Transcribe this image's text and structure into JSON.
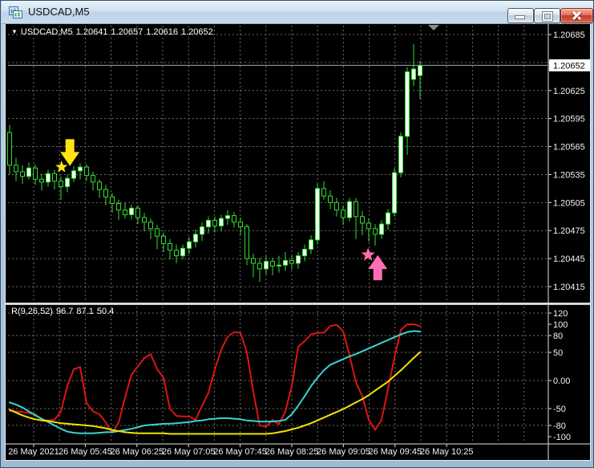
{
  "window": {
    "title": "USDCAD,M5",
    "controls": {
      "minimize": "minimize",
      "maximize": "maximize",
      "close": "close"
    }
  },
  "chart_header": {
    "dropdown": "▼",
    "symbol": "USDCAD,M5",
    "open": "1.20641",
    "high": "1.20657",
    "low": "1.20616",
    "close": "1.20652"
  },
  "indicator_header": {
    "label": "R(9,26,52)",
    "value1": "96.7",
    "value2": "87.1",
    "value3": "50.4"
  },
  "price_tag": "1.20652",
  "colors": {
    "background": "#000000",
    "grid": "#6F6F6F",
    "frame": "#E2E2E2",
    "candle": "#33DD33",
    "bull_fill": "#F2FFF2",
    "bear_fill": "#000000",
    "red_line": "#DE1414",
    "cyan_line": "#3BD2D2",
    "yellow_line": "#F2E400",
    "arrow_yellow": "#FFE312",
    "arrow_pink": "#FF6EB4",
    "price_line": "#A6A6A6",
    "axis_text": "#F2F2F2",
    "bar_marker": "#8C8C8C"
  },
  "chart_data": {
    "type": "candlestick",
    "symbol": "USDCAD",
    "timeframe": "M5",
    "title": "USDCAD,M5 1.20641 1.20657 1.20616 1.20652",
    "current_price": 1.20652,
    "price_axis_ticks": [
      "1.20685",
      "1.20655",
      "1.20625",
      "1.20595",
      "1.20565",
      "1.20535",
      "1.20505",
      "1.20475",
      "1.20445",
      "1.20415"
    ],
    "time_axis_labels": [
      "26 May 2021",
      "26 May 05:45",
      "26 May 06:25",
      "26 May 07:05",
      "26 May 07:45",
      "26 May 08:25",
      "26 May 09:05",
      "26 May 09:45",
      "26 May 10:25"
    ],
    "candles": [
      [
        1.2058,
        1.20588,
        1.20535,
        1.20545
      ],
      [
        1.20545,
        1.20553,
        1.20528,
        1.20538
      ],
      [
        1.20538,
        1.20545,
        1.20525,
        1.20533
      ],
      [
        1.20533,
        1.20548,
        1.2053,
        1.20542
      ],
      [
        1.20542,
        1.20546,
        1.20524,
        1.2053
      ],
      [
        1.2053,
        1.20536,
        1.20518,
        1.20527
      ],
      [
        1.20527,
        1.2054,
        1.20522,
        1.20536
      ],
      [
        1.20536,
        1.2054,
        1.20519,
        1.20528
      ],
      [
        1.20528,
        1.20533,
        1.20508,
        1.20522
      ],
      [
        1.20522,
        1.20535,
        1.20516,
        1.20531
      ],
      [
        1.20531,
        1.20544,
        1.20527,
        1.20539
      ],
      [
        1.20539,
        1.20547,
        1.2053,
        1.20543
      ],
      [
        1.20543,
        1.20546,
        1.20528,
        1.20534
      ],
      [
        1.20534,
        1.20538,
        1.20518,
        1.20527
      ],
      [
        1.20527,
        1.2053,
        1.2051,
        1.20519
      ],
      [
        1.20519,
        1.20524,
        1.20502,
        1.20511
      ],
      [
        1.20511,
        1.20515,
        1.20494,
        1.20504
      ],
      [
        1.20504,
        1.20508,
        1.20486,
        1.20497
      ],
      [
        1.20497,
        1.20505,
        1.20488,
        1.20492
      ],
      [
        1.20492,
        1.20503,
        1.20487,
        1.20499
      ],
      [
        1.20499,
        1.20502,
        1.20482,
        1.20489
      ],
      [
        1.20489,
        1.20494,
        1.20474,
        1.20484
      ],
      [
        1.20484,
        1.20488,
        1.20466,
        1.20477
      ],
      [
        1.20477,
        1.20481,
        1.20455,
        1.20469
      ],
      [
        1.20469,
        1.20473,
        1.20452,
        1.20461
      ],
      [
        1.20461,
        1.20466,
        1.20444,
        1.20454
      ],
      [
        1.20454,
        1.2046,
        1.2044,
        1.20448
      ],
      [
        1.20448,
        1.2046,
        1.20444,
        1.20456
      ],
      [
        1.20456,
        1.20468,
        1.2045,
        1.20463
      ],
      [
        1.20463,
        1.20476,
        1.20457,
        1.20471
      ],
      [
        1.20471,
        1.20484,
        1.20464,
        1.20479
      ],
      [
        1.20479,
        1.2049,
        1.20472,
        1.20486
      ],
      [
        1.20486,
        1.2049,
        1.20473,
        1.2048
      ],
      [
        1.2048,
        1.20492,
        1.20474,
        1.20488
      ],
      [
        1.20488,
        1.20497,
        1.20481,
        1.20491
      ],
      [
        1.20491,
        1.20495,
        1.20478,
        1.20484
      ],
      [
        1.20484,
        1.20489,
        1.2047,
        1.20479
      ],
      [
        1.20479,
        1.20482,
        1.20438,
        1.20445
      ],
      [
        1.20445,
        1.2045,
        1.20425,
        1.2044
      ],
      [
        1.2044,
        1.20446,
        1.2042,
        1.20434
      ],
      [
        1.20434,
        1.20448,
        1.20428,
        1.20442
      ],
      [
        1.20442,
        1.20446,
        1.20427,
        1.20437
      ],
      [
        1.20437,
        1.20448,
        1.2043,
        1.20438
      ],
      [
        1.20438,
        1.20452,
        1.20432,
        1.20443
      ],
      [
        1.20443,
        1.20448,
        1.20433,
        1.2044
      ],
      [
        1.2044,
        1.20452,
        1.20434,
        1.20448
      ],
      [
        1.20448,
        1.2046,
        1.20442,
        1.20455
      ],
      [
        1.20455,
        1.2047,
        1.2045,
        1.20465
      ],
      [
        1.20465,
        1.20525,
        1.2046,
        1.2052
      ],
      [
        1.2052,
        1.20528,
        1.20508,
        1.20512
      ],
      [
        1.20512,
        1.20518,
        1.20498,
        1.20505
      ],
      [
        1.20505,
        1.2051,
        1.2049,
        1.20497
      ],
      [
        1.20497,
        1.20502,
        1.20481,
        1.20489
      ],
      [
        1.20489,
        1.2051,
        1.20485,
        1.20506
      ],
      [
        1.20506,
        1.2051,
        1.20466,
        1.2049
      ],
      [
        1.2049,
        1.20496,
        1.2047,
        1.20483
      ],
      [
        1.20483,
        1.20488,
        1.20463,
        1.20477
      ],
      [
        1.20477,
        1.20482,
        1.20459,
        1.20471
      ],
      [
        1.20471,
        1.20486,
        1.20466,
        1.20482
      ],
      [
        1.20482,
        1.20498,
        1.20476,
        1.20494
      ],
      [
        1.20494,
        1.20542,
        1.2049,
        1.20537
      ],
      [
        1.20537,
        1.2058,
        1.20532,
        1.20576
      ],
      [
        1.20576,
        1.2065,
        1.20556,
        1.20645
      ],
      [
        1.20637,
        1.20675,
        1.2063,
        1.20648
      ],
      [
        1.20641,
        1.20657,
        1.20616,
        1.20652
      ]
    ],
    "markers": [
      {
        "shape": "star",
        "color": "#FFE312",
        "bar": 8.1,
        "price": 1.20543,
        "size": 8
      },
      {
        "shape": "arrow-down",
        "color": "#FFE312",
        "bar": 9.4,
        "price": 1.20545,
        "size": 32
      },
      {
        "shape": "star",
        "color": "#FF6EB4",
        "bar": 55.9,
        "price": 1.20449,
        "size": 9
      },
      {
        "shape": "arrow-up",
        "color": "#FF6EB4",
        "bar": 57.4,
        "price": 1.20448,
        "size": 30
      }
    ],
    "last_bar_marker_x": 540,
    "oscillator": {
      "name": "R(9,26,52)",
      "current_values": [
        96.7,
        87.1,
        50.4
      ],
      "axis_ticks": [
        "120",
        "100",
        "80",
        "50",
        "0.00",
        "-50",
        "-80",
        "-100"
      ],
      "level_lines": [
        120,
        80,
        50,
        0,
        -50,
        -80
      ],
      "range": [
        -100,
        120
      ],
      "series": [
        {
          "name": "fast",
          "color": "#DE1414",
          "values": [
            -54,
            -55,
            -56,
            -58,
            -60,
            -70,
            -71,
            -70,
            -55,
            -10,
            20,
            24,
            -40,
            -55,
            -60,
            -75,
            -93,
            -75,
            -30,
            10,
            25,
            40,
            47,
            20,
            5,
            -50,
            -63,
            -64,
            -64,
            -70,
            -45,
            -22,
            20,
            55,
            78,
            86,
            85,
            50,
            -20,
            -80,
            -82,
            -70,
            -78,
            -55,
            -10,
            60,
            70,
            82,
            85,
            85,
            97,
            99,
            88,
            45,
            -3,
            -28,
            -70,
            -88,
            -70,
            -15,
            40,
            90,
            100,
            100,
            96.7
          ]
        },
        {
          "name": "mid",
          "color": "#3BD2D2",
          "values": [
            -39,
            -43,
            -48,
            -55,
            -62,
            -68,
            -74,
            -80,
            -86,
            -91,
            -93,
            -94,
            -94,
            -94,
            -93,
            -92,
            -92,
            -90,
            -88,
            -86,
            -83,
            -80,
            -79,
            -78,
            -77,
            -77,
            -76,
            -75,
            -74,
            -72,
            -71,
            -69,
            -68,
            -67,
            -67,
            -68,
            -69,
            -71,
            -72,
            -73,
            -73,
            -73,
            -72,
            -70,
            -60,
            -45,
            -28,
            -10,
            5,
            18,
            28,
            33,
            38,
            43,
            47,
            52,
            57,
            62,
            67,
            72,
            77,
            82,
            86,
            88,
            87.1
          ]
        },
        {
          "name": "slow",
          "color": "#F2E400",
          "values": [
            -52,
            -57,
            -62,
            -66,
            -69,
            -71,
            -72,
            -74,
            -76,
            -77,
            -78,
            -79,
            -80,
            -81,
            -83,
            -85,
            -88,
            -90,
            -92,
            -93,
            -94,
            -94,
            -94,
            -94,
            -94,
            -95,
            -95,
            -95,
            -95,
            -95,
            -95,
            -95,
            -95,
            -95,
            -95,
            -95,
            -95,
            -95,
            -95,
            -95,
            -95,
            -94,
            -92,
            -90,
            -87,
            -84,
            -80,
            -76,
            -71,
            -66,
            -61,
            -56,
            -51,
            -45,
            -39,
            -33,
            -26,
            -18,
            -10,
            -2,
            8,
            18,
            29,
            40,
            50.4
          ]
        }
      ]
    }
  }
}
